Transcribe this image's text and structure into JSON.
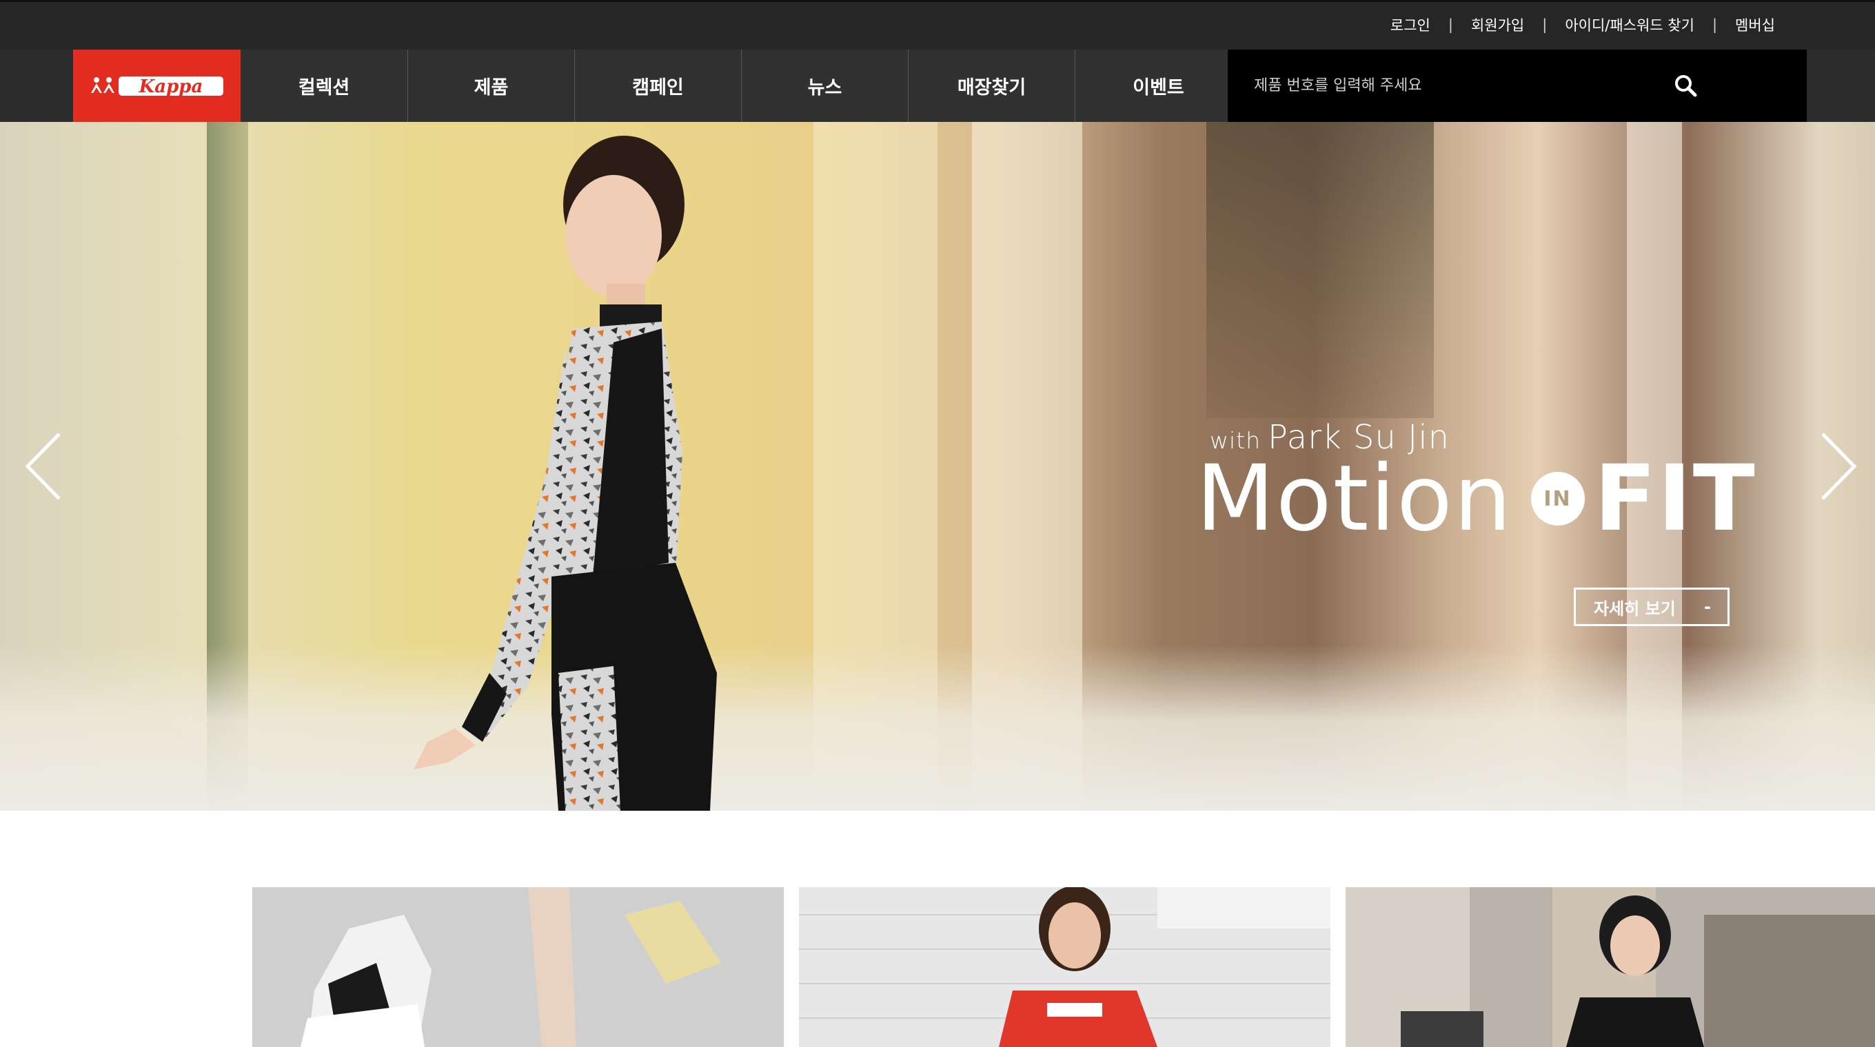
{
  "utility_nav": {
    "items": [
      "로그인",
      "회원가입",
      "아이디/패스워드 찾기",
      "멤버십"
    ],
    "separator": "|"
  },
  "brand": {
    "logo_text": "Kappa",
    "logo_color": "#e22c1f"
  },
  "main_nav": {
    "items": [
      "컬렉션",
      "제품",
      "캠페인",
      "뉴스",
      "매장찾기",
      "이벤트"
    ]
  },
  "search": {
    "placeholder": "제품 번호를 입력해 주세요",
    "icon": "search-icon"
  },
  "hero": {
    "tagline_with": "with",
    "tagline_name": "Park Su Jin",
    "headline_motion": "Motion",
    "headline_in": "IN",
    "headline_fit": "FIT",
    "cta_label": "자세히 보기",
    "cta_suffix": "-",
    "prev_icon": "chevron-left-icon",
    "next_icon": "chevron-right-icon"
  },
  "thumbnails": [
    {
      "subject": "sneaker-photo"
    },
    {
      "subject": "model-red-top-photo"
    },
    {
      "subject": "street-model-photo"
    }
  ],
  "colors": {
    "topbar": "#262626",
    "nav": "#2b2b2b",
    "search_bg": "#000000",
    "accent": "#e22c1f"
  }
}
